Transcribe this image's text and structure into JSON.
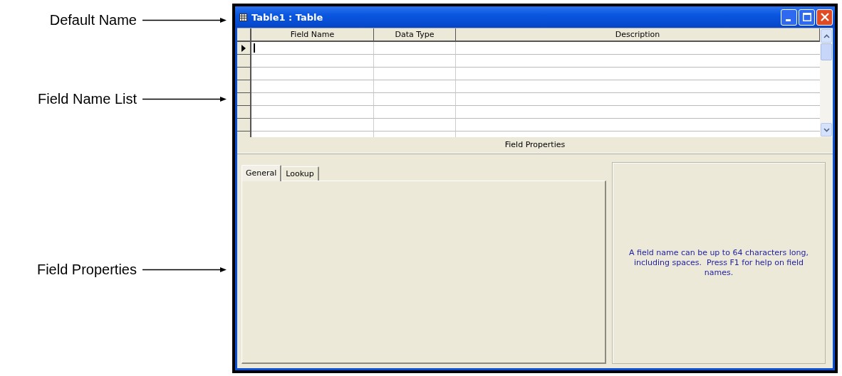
{
  "annotations": [
    {
      "label": "Default Name"
    },
    {
      "label": "Field Name List"
    },
    {
      "label": "Field Properties"
    }
  ],
  "window": {
    "title": "Table1 : Table"
  },
  "grid": {
    "columns": [
      "Field Name",
      "Data Type",
      "Description"
    ],
    "rows": [
      {
        "selected": true
      },
      {
        "selected": false
      },
      {
        "selected": false
      },
      {
        "selected": false
      },
      {
        "selected": false
      },
      {
        "selected": false
      },
      {
        "selected": false
      }
    ]
  },
  "section_label": "Field Properties",
  "tabs": [
    {
      "label": "General",
      "selected": true
    },
    {
      "label": "Lookup",
      "selected": false
    }
  ],
  "help_text": "A field name can be up to 64 characters long, including spaces.  Press F1 for help on field names."
}
